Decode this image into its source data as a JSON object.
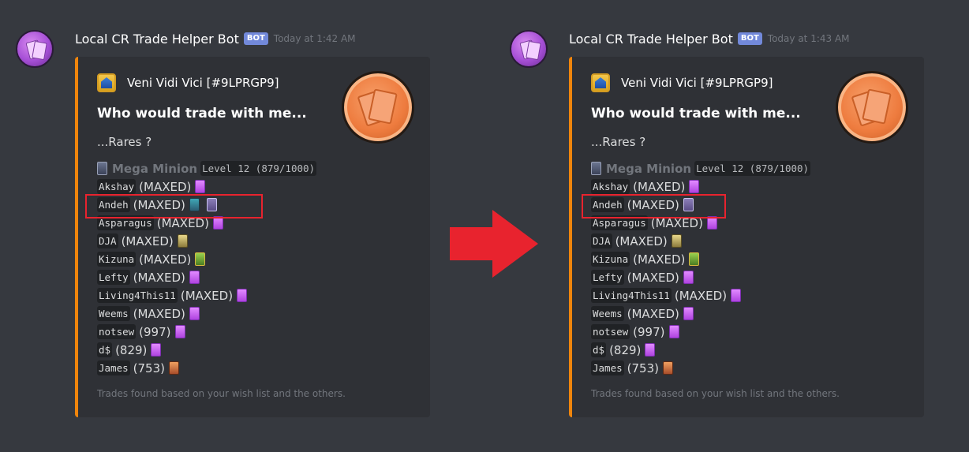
{
  "messages": [
    {
      "username": "Local CR Trade Helper Bot",
      "bot_tag": "BOT",
      "timestamp": "Today at 1:42 AM",
      "embed": {
        "author": "Veni Vidi Vici [#9LPRGP9]",
        "title": "Who would trade with me...",
        "description": "...Rares ?",
        "card_name": "Mega Minion",
        "card_level": "Level 12 (879/1000)",
        "rows": [
          {
            "name": "Akshay",
            "status": "(MAXED)",
            "icons": [
              "purple-card-icon"
            ]
          },
          {
            "name": "Andeh",
            "status": "(MAXED)",
            "icons": [
              "teal-card-icon",
              "mega-minion-card-icon"
            ]
          },
          {
            "name": "Asparagus",
            "status": "(MAXED)",
            "icons": [
              "purple-card-icon"
            ]
          },
          {
            "name": "DJA",
            "status": "(MAXED)",
            "icons": [
              "yellow-card-icon"
            ]
          },
          {
            "name": "Kizuna",
            "status": "(MAXED)",
            "icons": [
              "green-card-icon"
            ]
          },
          {
            "name": "Lefty",
            "status": "(MAXED)",
            "icons": [
              "purple-card-icon"
            ]
          },
          {
            "name": "Living4This11",
            "status": "(MAXED)",
            "icons": [
              "purple-card-icon"
            ]
          },
          {
            "name": "Weems",
            "status": "(MAXED)",
            "icons": [
              "purple-card-icon"
            ]
          },
          {
            "name": "notsew",
            "status": "(997)",
            "icons": [
              "purple-card-icon"
            ]
          },
          {
            "name": "d$",
            "status": "(829)",
            "icons": [
              "purple-card-icon"
            ]
          },
          {
            "name": "James",
            "status": "(753)",
            "icons": [
              "orange-card-icon"
            ]
          }
        ],
        "footer": "Trades found based on your wish list and the others."
      }
    },
    {
      "username": "Local CR Trade Helper Bot",
      "bot_tag": "BOT",
      "timestamp": "Today at 1:43 AM",
      "embed": {
        "author": "Veni Vidi Vici [#9LPRGP9]",
        "title": "Who would trade with me...",
        "description": "...Rares ?",
        "card_name": "Mega Minion",
        "card_level": "Level 12 (879/1000)",
        "rows": [
          {
            "name": "Akshay",
            "status": "(MAXED)",
            "icons": [
              "purple-card-icon"
            ]
          },
          {
            "name": "Andeh",
            "status": "(MAXED)",
            "icons": [
              "mega-minion-card-icon"
            ]
          },
          {
            "name": "Asparagus",
            "status": "(MAXED)",
            "icons": [
              "purple-card-icon"
            ]
          },
          {
            "name": "DJA",
            "status": "(MAXED)",
            "icons": [
              "yellow-card-icon"
            ]
          },
          {
            "name": "Kizuna",
            "status": "(MAXED)",
            "icons": [
              "green-card-icon"
            ]
          },
          {
            "name": "Lefty",
            "status": "(MAXED)",
            "icons": [
              "purple-card-icon"
            ]
          },
          {
            "name": "Living4This11",
            "status": "(MAXED)",
            "icons": [
              "purple-card-icon"
            ]
          },
          {
            "name": "Weems",
            "status": "(MAXED)",
            "icons": [
              "purple-card-icon"
            ]
          },
          {
            "name": "notsew",
            "status": "(997)",
            "icons": [
              "purple-card-icon"
            ]
          },
          {
            "name": "d$",
            "status": "(829)",
            "icons": [
              "purple-card-icon"
            ]
          },
          {
            "name": "James",
            "status": "(753)",
            "icons": [
              "orange-card-icon"
            ]
          }
        ],
        "footer": "Trades found based on your wish list and the others."
      }
    }
  ],
  "colors": {
    "background": "#36393f",
    "embed_bg": "#2f3136",
    "embed_accent": "#f0850c",
    "bot_tag": "#7289da",
    "highlight": "#e8232e",
    "arrow": "#e8232e"
  }
}
